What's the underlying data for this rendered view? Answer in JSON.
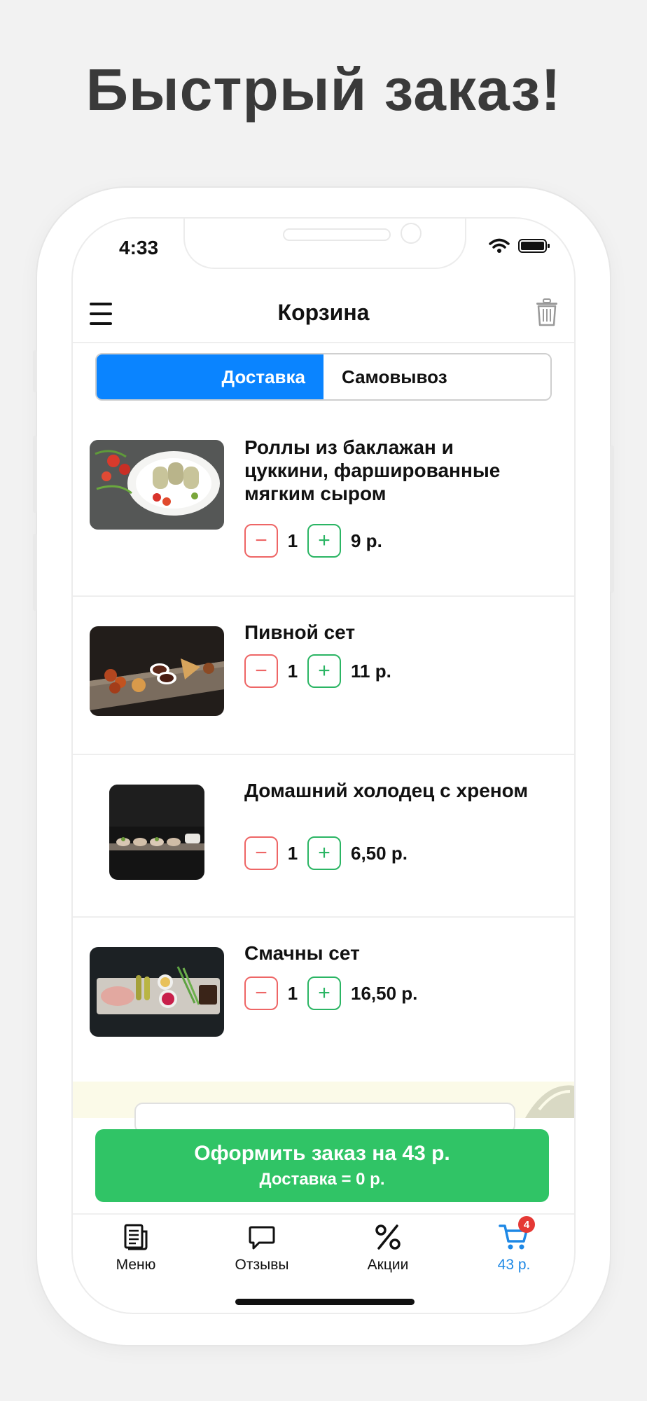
{
  "headline": "Быстрый заказ!",
  "status_bar": {
    "time": "4:33"
  },
  "header": {
    "title": "Корзина"
  },
  "delivery_toggle": {
    "delivery": "Доставка",
    "pickup": "Самовывоз",
    "selected": "Доставка"
  },
  "cart_items": [
    {
      "name": "Роллы из баклажан и цуккини, фаршированные мягким сыром",
      "quantity": "1",
      "price": "9 р."
    },
    {
      "name": "Пивной сет",
      "quantity": "1",
      "price": "11 р."
    },
    {
      "name": "Домашний холодец с хреном",
      "quantity": "1",
      "price": "6,50 р."
    },
    {
      "name": "Смачны сет",
      "quantity": "1",
      "price": "16,50 р."
    }
  ],
  "order_button": {
    "label": "Оформить заказ на 43 р.",
    "delivery_note": "Доставка = 0 р."
  },
  "tab_bar": {
    "menu": "Меню",
    "reviews": "Отзывы",
    "promotions": "Акции",
    "cart": "43 р.",
    "cart_badge": "4"
  },
  "colors": {
    "accent": "#0a84ff",
    "order_green": "#30c466",
    "minus_red": "#ee6666",
    "plus_green": "#2bb564"
  }
}
